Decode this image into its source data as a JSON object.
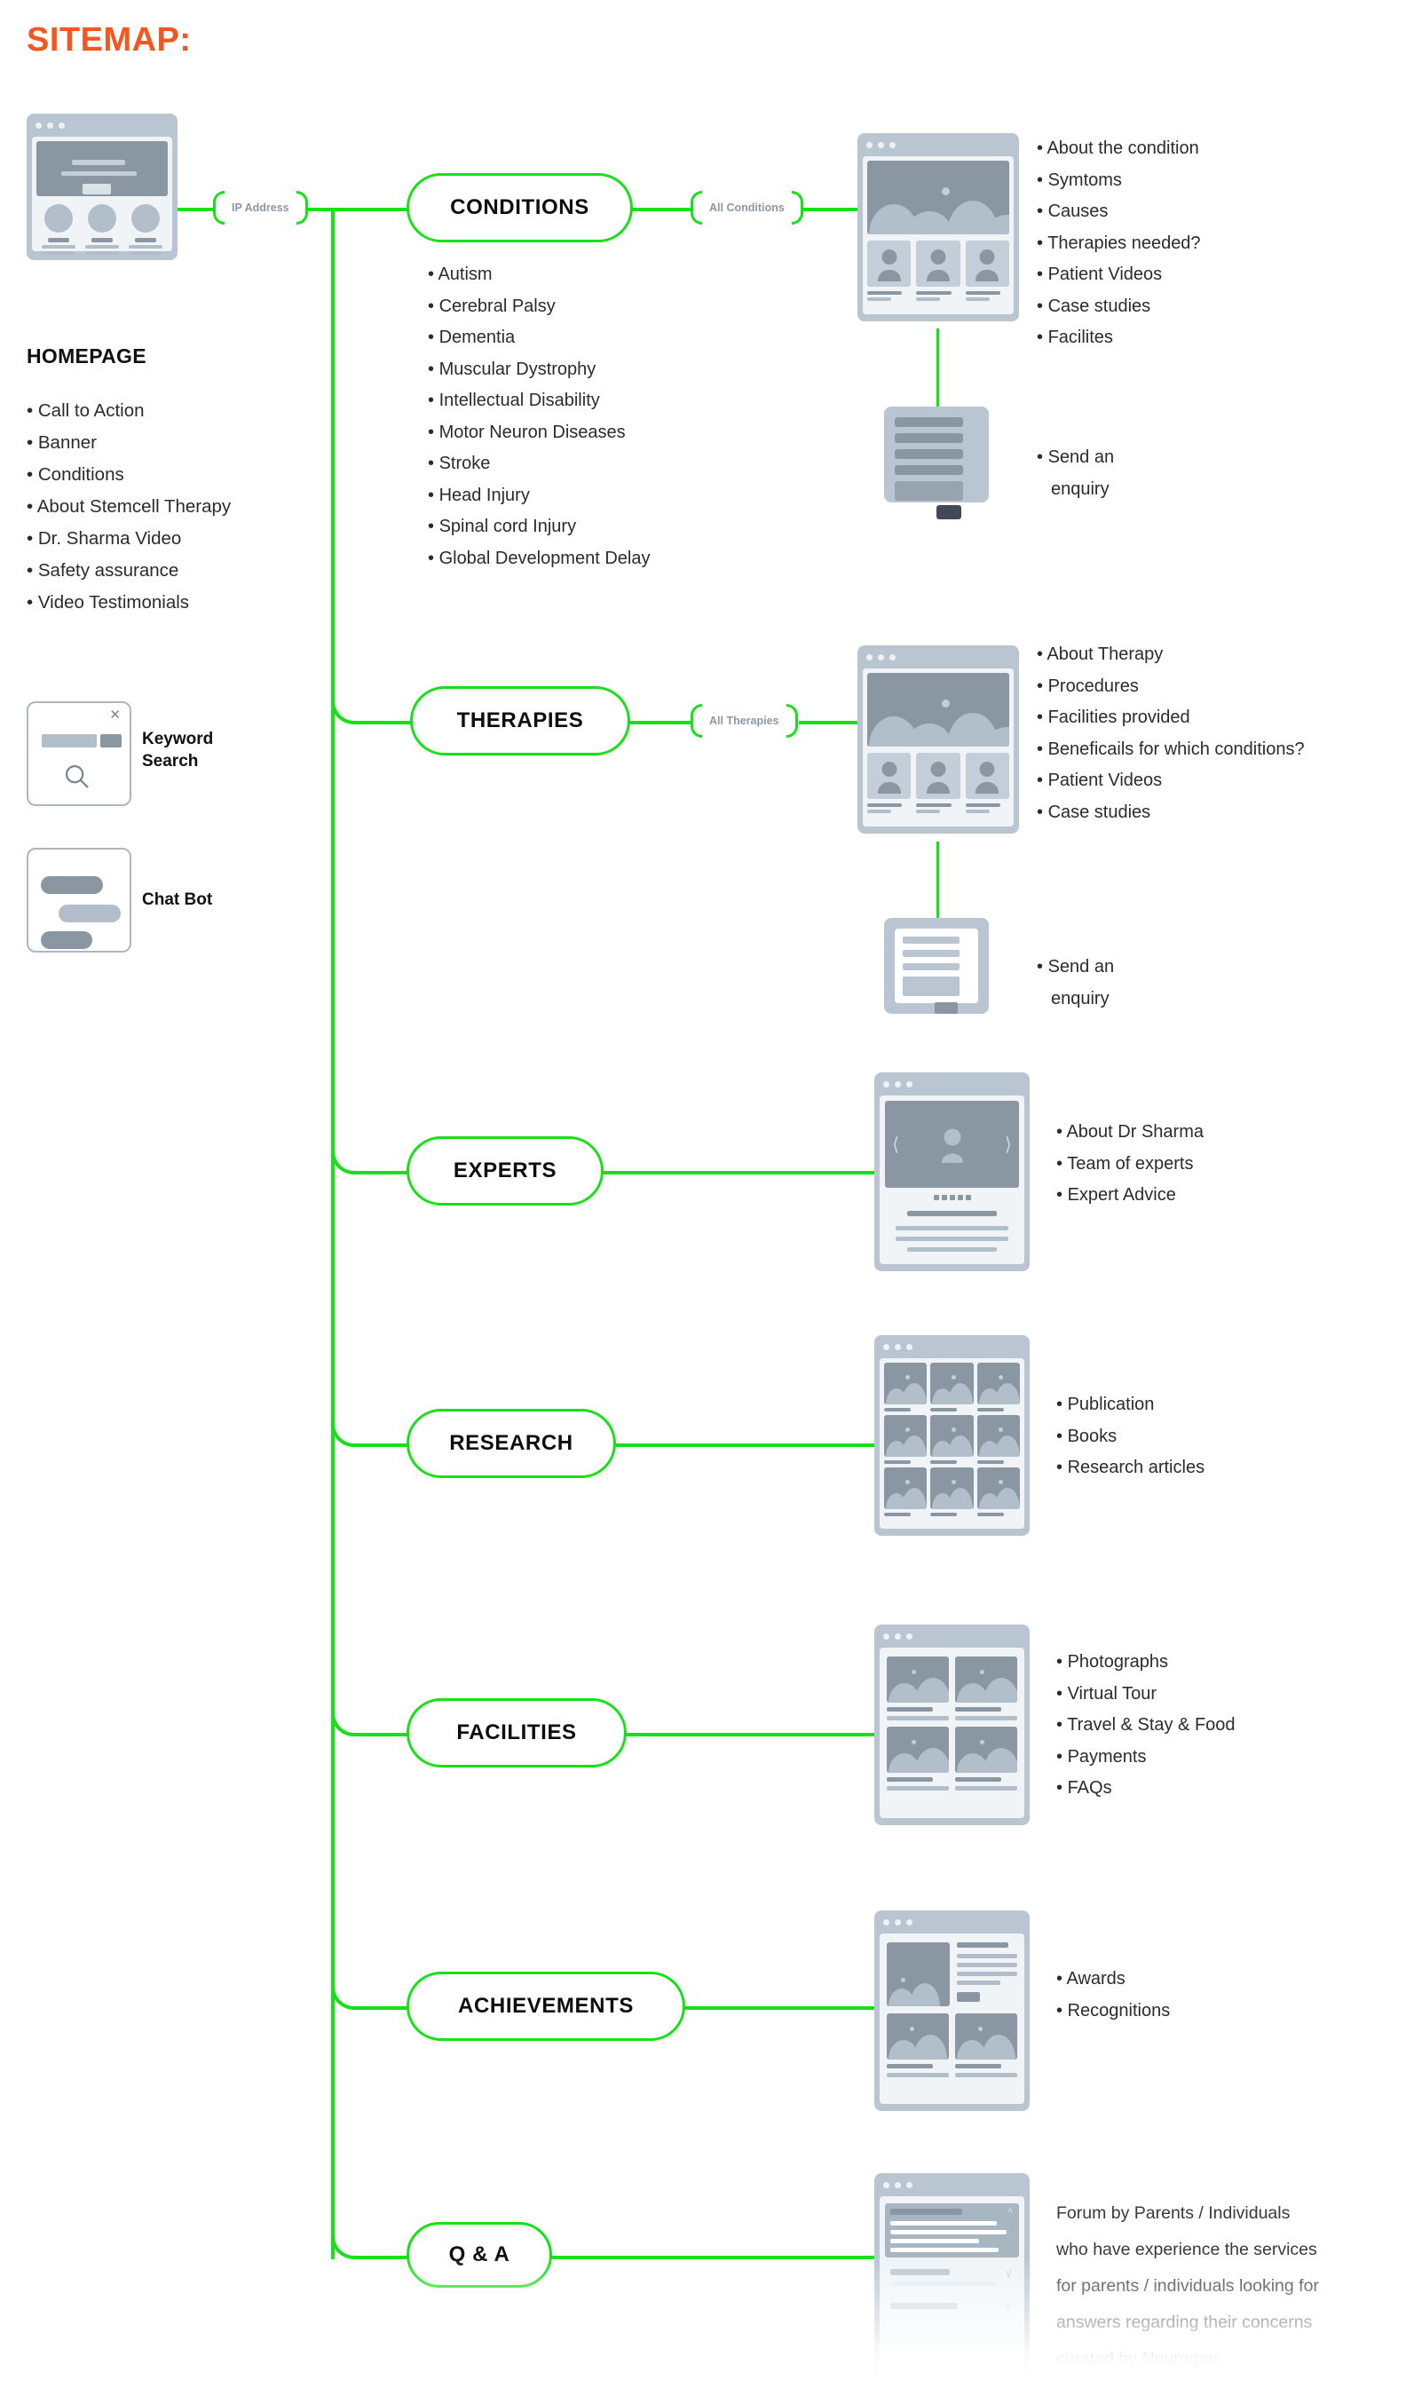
{
  "title": "SITEMAP:",
  "accent_green": "#16e016",
  "accent_orange": "#f4561f",
  "homepage": {
    "heading": "HOMEPAGE",
    "items": [
      "Call to Action",
      "Banner",
      "Conditions",
      "About Stemcell Therapy",
      "Dr. Sharma Video",
      "Safety assurance",
      "Video Testimonials"
    ]
  },
  "widgets": [
    {
      "label_line1": "Keyword",
      "label_line2": "Search",
      "icon": "magnifier-icon",
      "close_icon": "close-icon"
    },
    {
      "label_line1": "Chat Bot",
      "label_line2": "",
      "icon": "chat-bubbles-icon"
    }
  ],
  "connectors": {
    "ip_address": "IP Address",
    "all_conditions": "All Conditions",
    "all_therapies": "All Therapies"
  },
  "nodes": [
    {
      "label": "CONDITIONS",
      "sub_items": [
        "Autism",
        "Cerebral Palsy",
        "Dementia",
        "Muscular Dystrophy",
        "Intellectual Disability",
        "Motor Neuron Diseases",
        "Stroke",
        "Head Injury",
        "Spinal cord Injury",
        "Global Development Delay"
      ],
      "detail_items": [
        "About the condition",
        "Symtoms",
        "Causes",
        "Therapies needed?",
        "Patient Videos",
        "Case studies",
        "Facilites"
      ],
      "enquiry": "Send an\nenquiry"
    },
    {
      "label": "THERAPIES",
      "sub_items": [],
      "detail_items": [
        "About Therapy",
        "Procedures",
        "Facilities provided",
        "Beneficails for which conditions?",
        "Patient Videos",
        "Case studies"
      ],
      "enquiry": "Send an\nenquiry"
    },
    {
      "label": "EXPERTS",
      "sub_items": [],
      "detail_items": [
        "About Dr Sharma",
        "Team of experts",
        "Expert Advice"
      ]
    },
    {
      "label": "RESEARCH",
      "sub_items": [],
      "detail_items": [
        "Publication",
        "Books",
        "Research articles"
      ]
    },
    {
      "label": "FACILITIES",
      "sub_items": [],
      "detail_items": [
        "Photographs",
        "Virtual Tour",
        "Travel & Stay & Food",
        "Payments",
        "FAQs"
      ]
    },
    {
      "label": "ACHIEVEMENTS",
      "sub_items": [],
      "detail_items": [
        "Awards",
        "Recognitions"
      ]
    },
    {
      "label": "Q & A",
      "sub_items": [],
      "detail_items": [],
      "paragraph_lines": [
        "Forum by Parents / Individuals",
        "who have experience the services",
        "for parents / individuals looking for",
        "answers regarding their concerns",
        "curated by Neurogen."
      ]
    }
  ],
  "enquiry_labels": {
    "conditions": "Send an",
    "conditions2": "enquiry",
    "therapies": "Send an",
    "therapies2": "enquiry"
  }
}
